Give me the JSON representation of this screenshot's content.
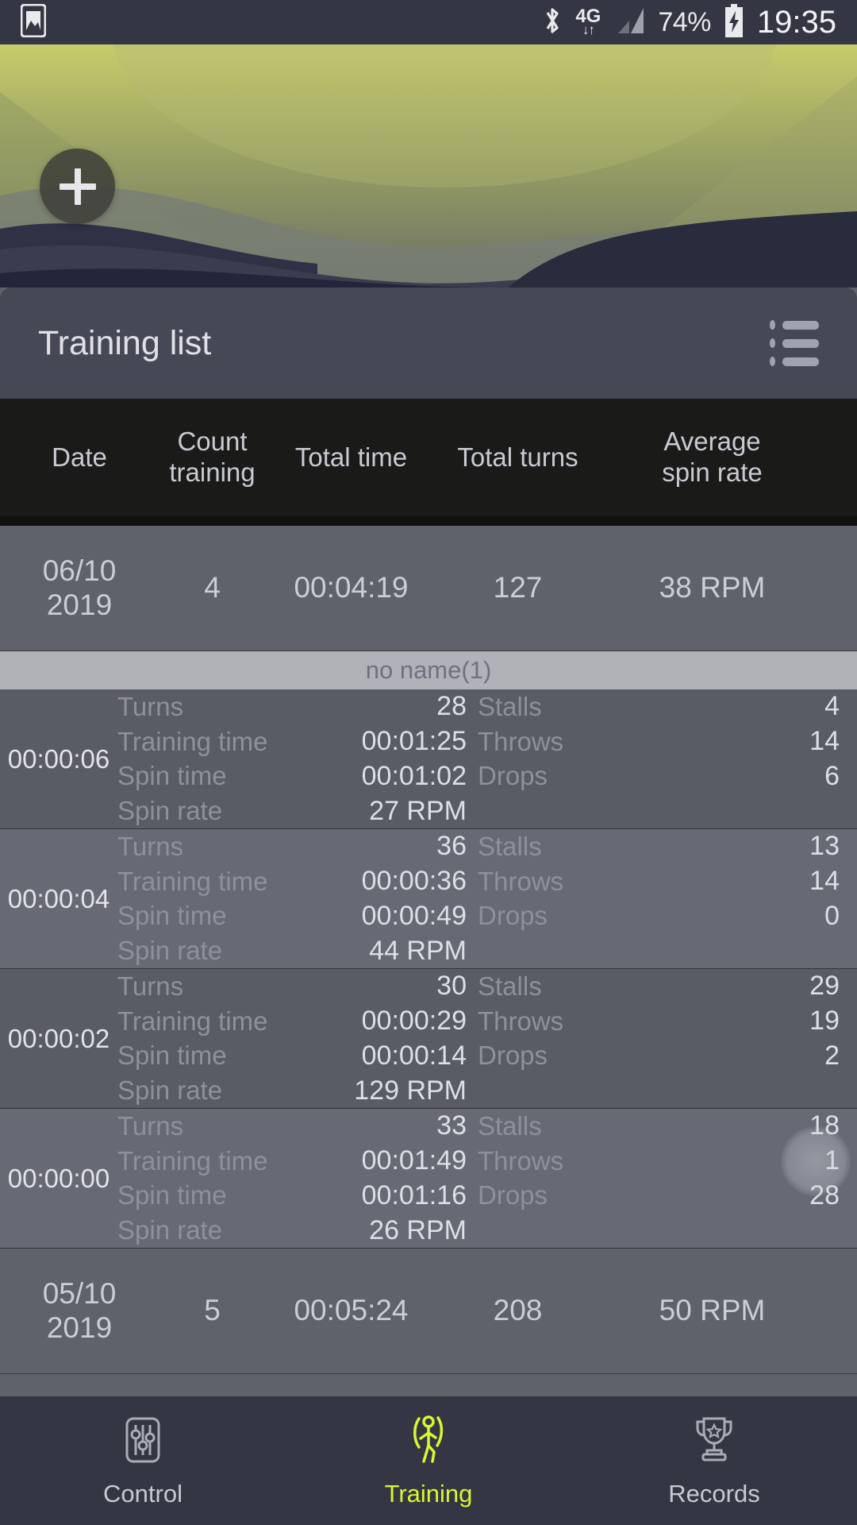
{
  "statusbar": {
    "gallery_icon": "image-icon",
    "bluetooth_icon": "bluetooth-icon",
    "network_type": "4G",
    "data_arrows": "↓↑",
    "signal_icon": "signal-bars-icon",
    "battery_percent": "74%",
    "battery_icon": "battery-charging-icon",
    "clock": "19:35"
  },
  "hero": {
    "add_button_label": "+",
    "add_button_name": "add-training-button"
  },
  "panel": {
    "title": "Training list",
    "menu_icon": "list-menu-icon"
  },
  "table": {
    "headers": {
      "date": "Date",
      "count_training": "Count training",
      "count_training_line1": "Count",
      "count_training_line2": "training",
      "total_time": "Total time",
      "total_turns": "Total turns",
      "average_spin_rate_line1": "Average",
      "average_spin_rate_line2": "spin rate"
    },
    "labels": {
      "turns": "Turns",
      "stalls": "Stalls",
      "training_time": "Training time",
      "throws": "Throws",
      "spin_time": "Spin time",
      "drops": "Drops",
      "spin_rate": "Spin rate"
    },
    "sessions": [
      {
        "date_line1": "06/10",
        "date_line2": "2019",
        "count_training": "4",
        "total_time": "00:04:19",
        "total_turns": "127",
        "average_spin_rate": "38 RPM",
        "group_label": "no name(1)",
        "entries": [
          {
            "time": "00:00:06",
            "turns": "28",
            "stalls": "4",
            "training_time": "00:01:25",
            "throws": "14",
            "spin_time": "00:01:02",
            "drops": "6",
            "spin_rate": "27 RPM"
          },
          {
            "time": "00:00:04",
            "turns": "36",
            "stalls": "13",
            "training_time": "00:00:36",
            "throws": "14",
            "spin_time": "00:00:49",
            "drops": "0",
            "spin_rate": "44 RPM"
          },
          {
            "time": "00:00:02",
            "turns": "30",
            "stalls": "29",
            "training_time": "00:00:29",
            "throws": "19",
            "spin_time": "00:00:14",
            "drops": "2",
            "spin_rate": "129 RPM"
          },
          {
            "time": "00:00:00",
            "turns": "33",
            "stalls": "18",
            "training_time": "00:01:49",
            "throws": "1",
            "spin_time": "00:01:16",
            "drops": "28",
            "spin_rate": "26 RPM"
          }
        ]
      },
      {
        "date_line1": "05/10",
        "date_line2": "2019",
        "count_training": "5",
        "total_time": "00:05:24",
        "total_turns": "208",
        "average_spin_rate": "50 RPM",
        "group_label": "",
        "entries": []
      }
    ]
  },
  "bottom_nav": {
    "items": [
      {
        "label": "Control",
        "icon": "sliders-icon",
        "active": false
      },
      {
        "label": "Training",
        "icon": "runner-icon",
        "active": true
      },
      {
        "label": "Records",
        "icon": "trophy-icon",
        "active": false
      }
    ],
    "active_color": "#d7f731"
  }
}
